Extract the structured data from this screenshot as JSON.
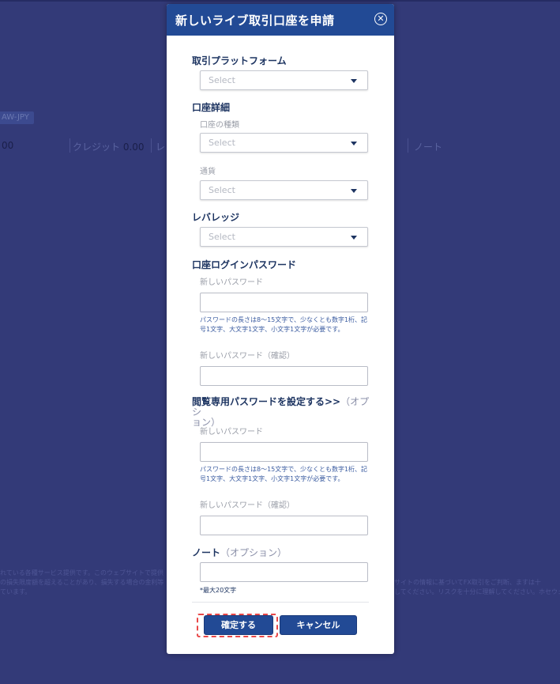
{
  "background": {
    "badge": "AW-JPY",
    "left_value": "00",
    "credit_label": "クレジット",
    "credit_value": "0.00",
    "leverage_stub": "レ",
    "note_label": "ノート",
    "disclaimer_left_1": "れている各種サービス提供です。このウェブサイトで提供",
    "disclaimer_left_2": "の損失限度額を超えることがあり、損失する場合の金利等",
    "disclaimer_left_3": "ています。",
    "disclaimer_right_1": "サイトの情報に基づいてFX取引をご判断、ますは十",
    "disclaimer_right_2": "してください。リスクを十分に理解してください。ホセウェ"
  },
  "modal": {
    "title": "新しいライブ取引口座を申請",
    "platform": {
      "title": "取引プラットフォーム",
      "select_placeholder": "Select"
    },
    "account": {
      "title": "口座詳細",
      "type_label": "口座の種類",
      "type_placeholder": "Select",
      "currency_label": "通貨",
      "currency_placeholder": "Select"
    },
    "leverage": {
      "title": "レバレッジ",
      "select_placeholder": "Select"
    },
    "login_password": {
      "title": "口座ログインパスワード",
      "new_label": "新しいパスワード",
      "help_line1": "パスワードの長さは8～15文字で、少なくとも数字1桁、記",
      "help_line2": "号1文字、大文字1文字、小文字1文字が必要です。",
      "confirm_label": "新しいパスワード（確認）"
    },
    "readonly_password": {
      "title_line1": "閲覧専用パスワードを設定する>>",
      "optional": "（オプシ",
      "title_line2": "ョン）",
      "new_label": "新しいパスワード",
      "help_line1": "パスワードの長さは8～15文字で、少なくとも数字1桁、記",
      "help_line2": "号1文字、大文字1文字、小文字1文字が必要です。",
      "confirm_label": "新しいパスワード（確認）"
    },
    "note": {
      "title": "ノート",
      "optional": "（オプション）",
      "hint": "*最大20文字"
    },
    "buttons": {
      "confirm": "確定する",
      "cancel": "キャンセル"
    }
  }
}
